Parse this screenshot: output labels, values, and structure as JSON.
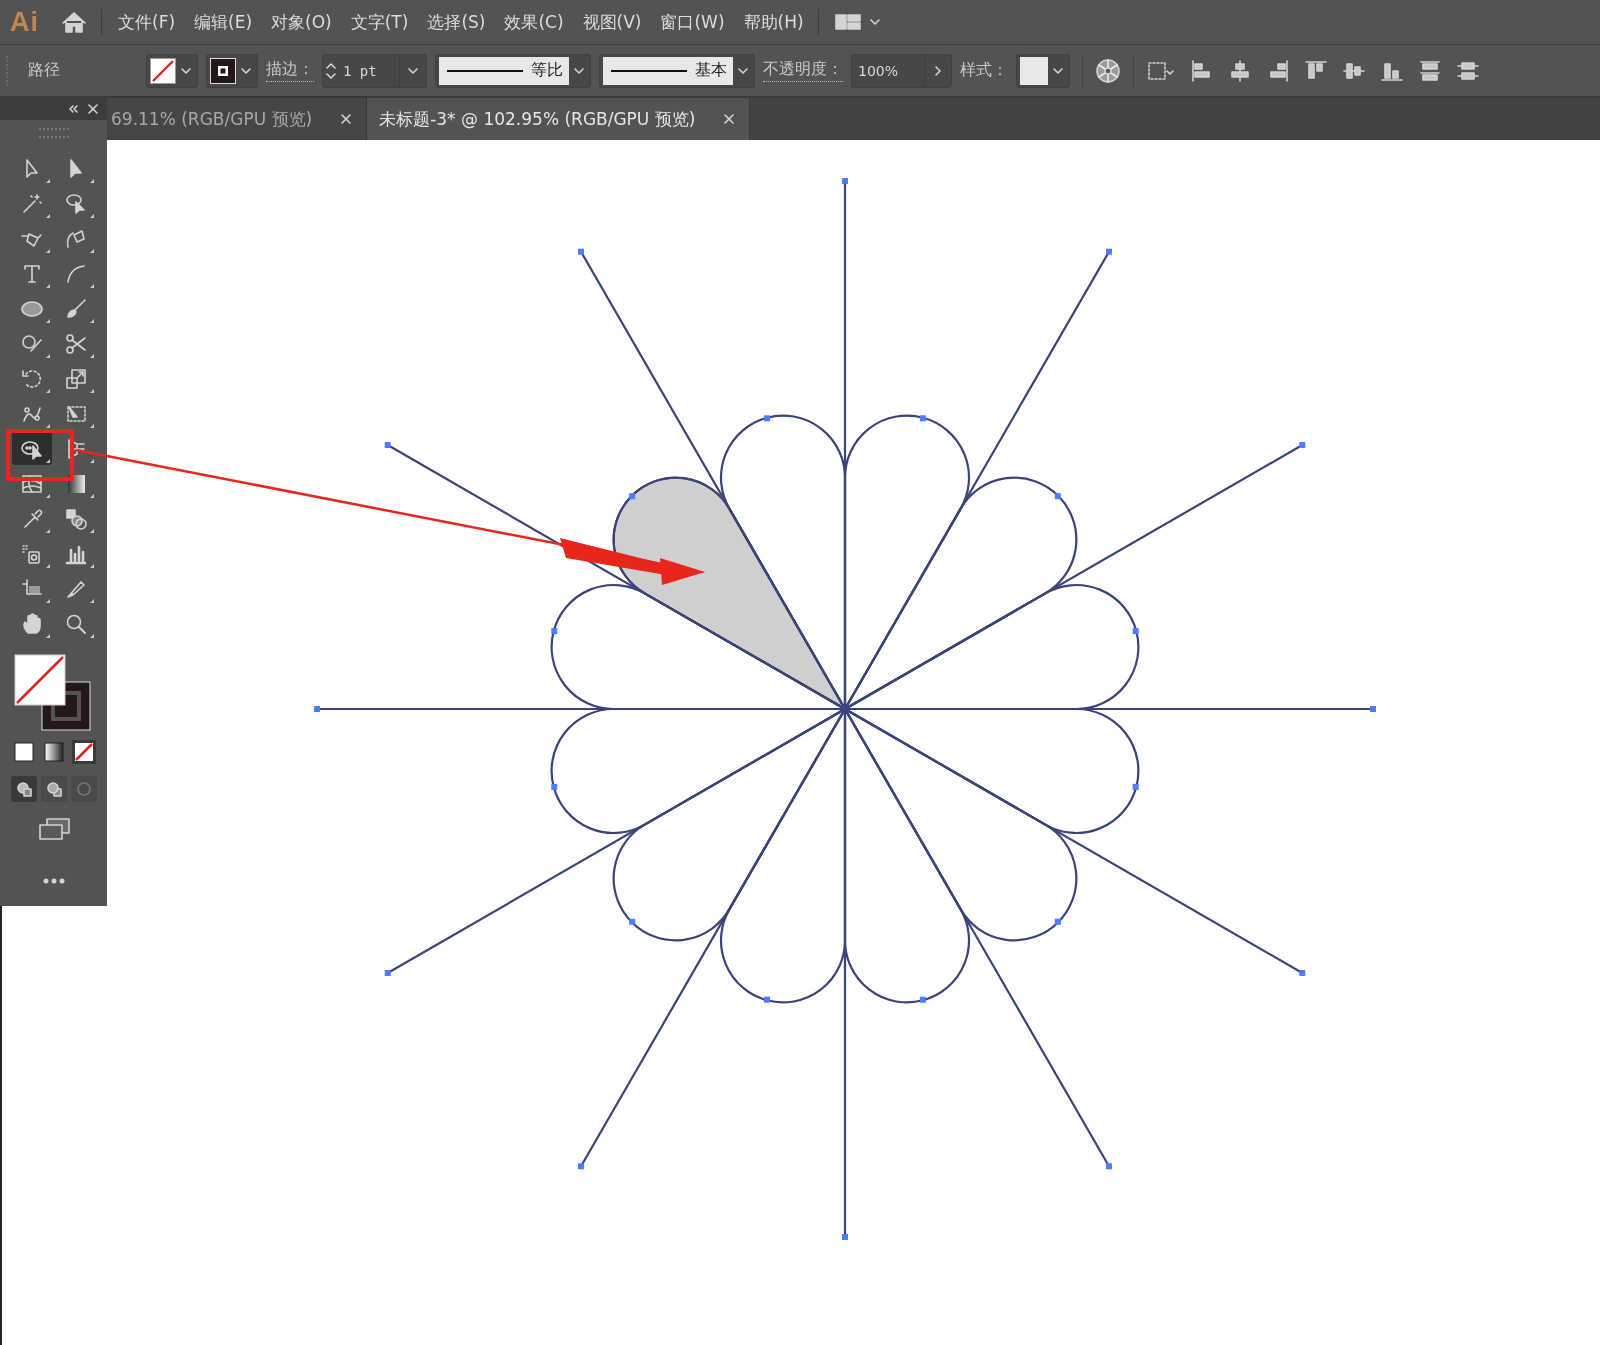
{
  "app": {
    "logo": "Ai"
  },
  "menu": [
    "文件(F)",
    "编辑(E)",
    "对象(O)",
    "文字(T)",
    "选择(S)",
    "效果(C)",
    "视图(V)",
    "窗口(W)",
    "帮助(H)"
  ],
  "control_bar": {
    "selection_label": "路径",
    "stroke_label": "描边：",
    "stroke_weight": "1 pt",
    "profile_label": "等比",
    "brush_label": "基本",
    "opacity_label": "不透明度：",
    "opacity_value": "100%",
    "style_label": "样式："
  },
  "tabs": [
    {
      "label": "69.11% (RGB/GPU 预览)",
      "selected": false
    },
    {
      "label": "未标题-3* @ 102.95% (RGB/GPU 预览)",
      "selected": true
    }
  ],
  "tools": [
    {
      "selected": false
    },
    {
      "selected": false
    },
    {
      "selected": false
    },
    {
      "selected": false
    },
    {
      "selected": false
    },
    {
      "selected": false
    },
    {
      "selected": false
    },
    {
      "selected": false
    },
    {
      "selected": false
    },
    {
      "selected": false
    },
    {
      "selected": false
    },
    {
      "selected": false
    },
    {
      "selected": false
    },
    {
      "selected": false
    },
    {
      "selected": false
    },
    {
      "selected": false
    },
    {
      "selected": true
    },
    {
      "selected": false
    },
    {
      "selected": false
    },
    {
      "selected": false
    },
    {
      "selected": false
    },
    {
      "selected": false
    },
    {
      "selected": false
    },
    {
      "selected": false
    },
    {
      "selected": false
    },
    {
      "selected": false
    },
    {
      "selected": false
    },
    {
      "selected": false
    }
  ]
}
